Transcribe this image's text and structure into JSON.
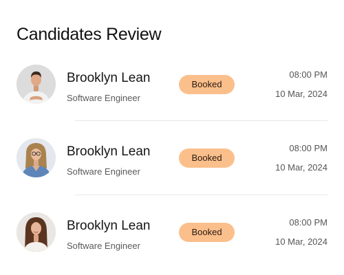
{
  "title": "Candidates Review",
  "colors": {
    "badge_bg": "#fbbf8c",
    "divider": "#e7e7e7"
  },
  "candidates": [
    {
      "name": "Brooklyn Lean",
      "role": "Software Engineer",
      "status": "Booked",
      "time": "08:00 PM",
      "date": "10 Mar, 2024",
      "avatar": "male-portrait"
    },
    {
      "name": "Brooklyn Lean",
      "role": "Software Engineer",
      "status": "Booked",
      "time": "08:00 PM",
      "date": "10 Mar, 2024",
      "avatar": "female-portrait-glasses"
    },
    {
      "name": "Brooklyn Lean",
      "role": "Software Engineer",
      "status": "Booked",
      "time": "08:00 PM",
      "date": "10 Mar, 2024",
      "avatar": "female-portrait"
    }
  ]
}
